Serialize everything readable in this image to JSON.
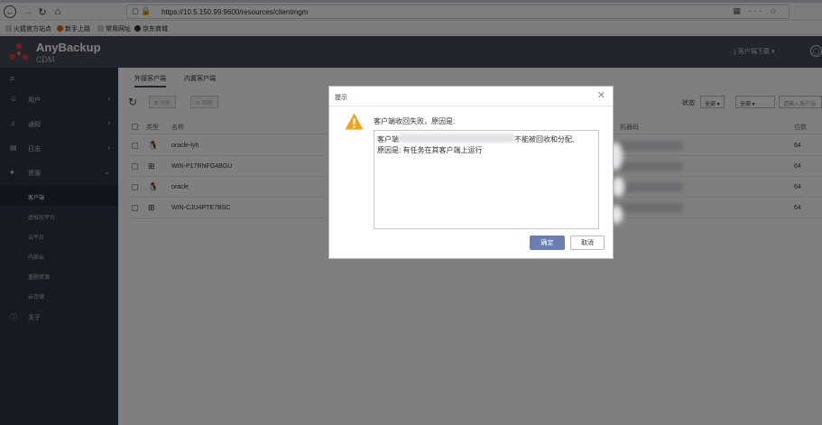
{
  "browser": {
    "url": "https://10.5.150.99:9600/resources/clientmgm",
    "bookmarks": [
      "火狐官方站点",
      "新手上路",
      "常用网址",
      "京东商城"
    ]
  },
  "app": {
    "brand": "AnyBackup",
    "product": "CDM",
    "download_label": "客户端下载 ▾"
  },
  "sidebar": {
    "items": [
      {
        "label": "用户",
        "icon": "user-icon"
      },
      {
        "label": "通知",
        "icon": "bell-icon"
      },
      {
        "label": "日志",
        "icon": "log-icon"
      },
      {
        "label": "资源",
        "icon": "resource-icon"
      },
      {
        "label": "关于",
        "icon": "info-icon"
      }
    ],
    "subitems": [
      "客户端",
      "虚拟化平台",
      "云平台",
      "内部云",
      "重删资源",
      "云存储"
    ],
    "active_sub": "客户端"
  },
  "main": {
    "tabs": [
      "外接客户端",
      "内置客户端"
    ],
    "toolbar": {
      "assign": "分配",
      "recycle": "回收"
    },
    "filter": {
      "state_label": "状态:",
      "select1": "全部 ▾",
      "select2": "全部 ▾",
      "search_placeholder": "请输入客户端"
    },
    "columns": {
      "type": "类型",
      "name": "名称",
      "code": "机器码",
      "bits": "位数"
    },
    "rows": [
      {
        "os": "linux",
        "name": "oracle-lyh",
        "bits": "64"
      },
      {
        "os": "windows",
        "name": "WIN-P17RNFG4BGU",
        "bits": "64"
      },
      {
        "os": "linux",
        "name": "oracle",
        "bits": "64"
      },
      {
        "os": "windows",
        "name": "WIN-CJU4PTE7BSC",
        "bits": "64"
      }
    ]
  },
  "dialog": {
    "title": "提示",
    "message": "客户端收回失败，原因是:",
    "detail_prefix": "客户端",
    "detail_suffix": "不能被回收和分配,",
    "detail_line2": "原因是: 有任务在其客户端上运行",
    "ok": "确定",
    "cancel": "取消"
  }
}
